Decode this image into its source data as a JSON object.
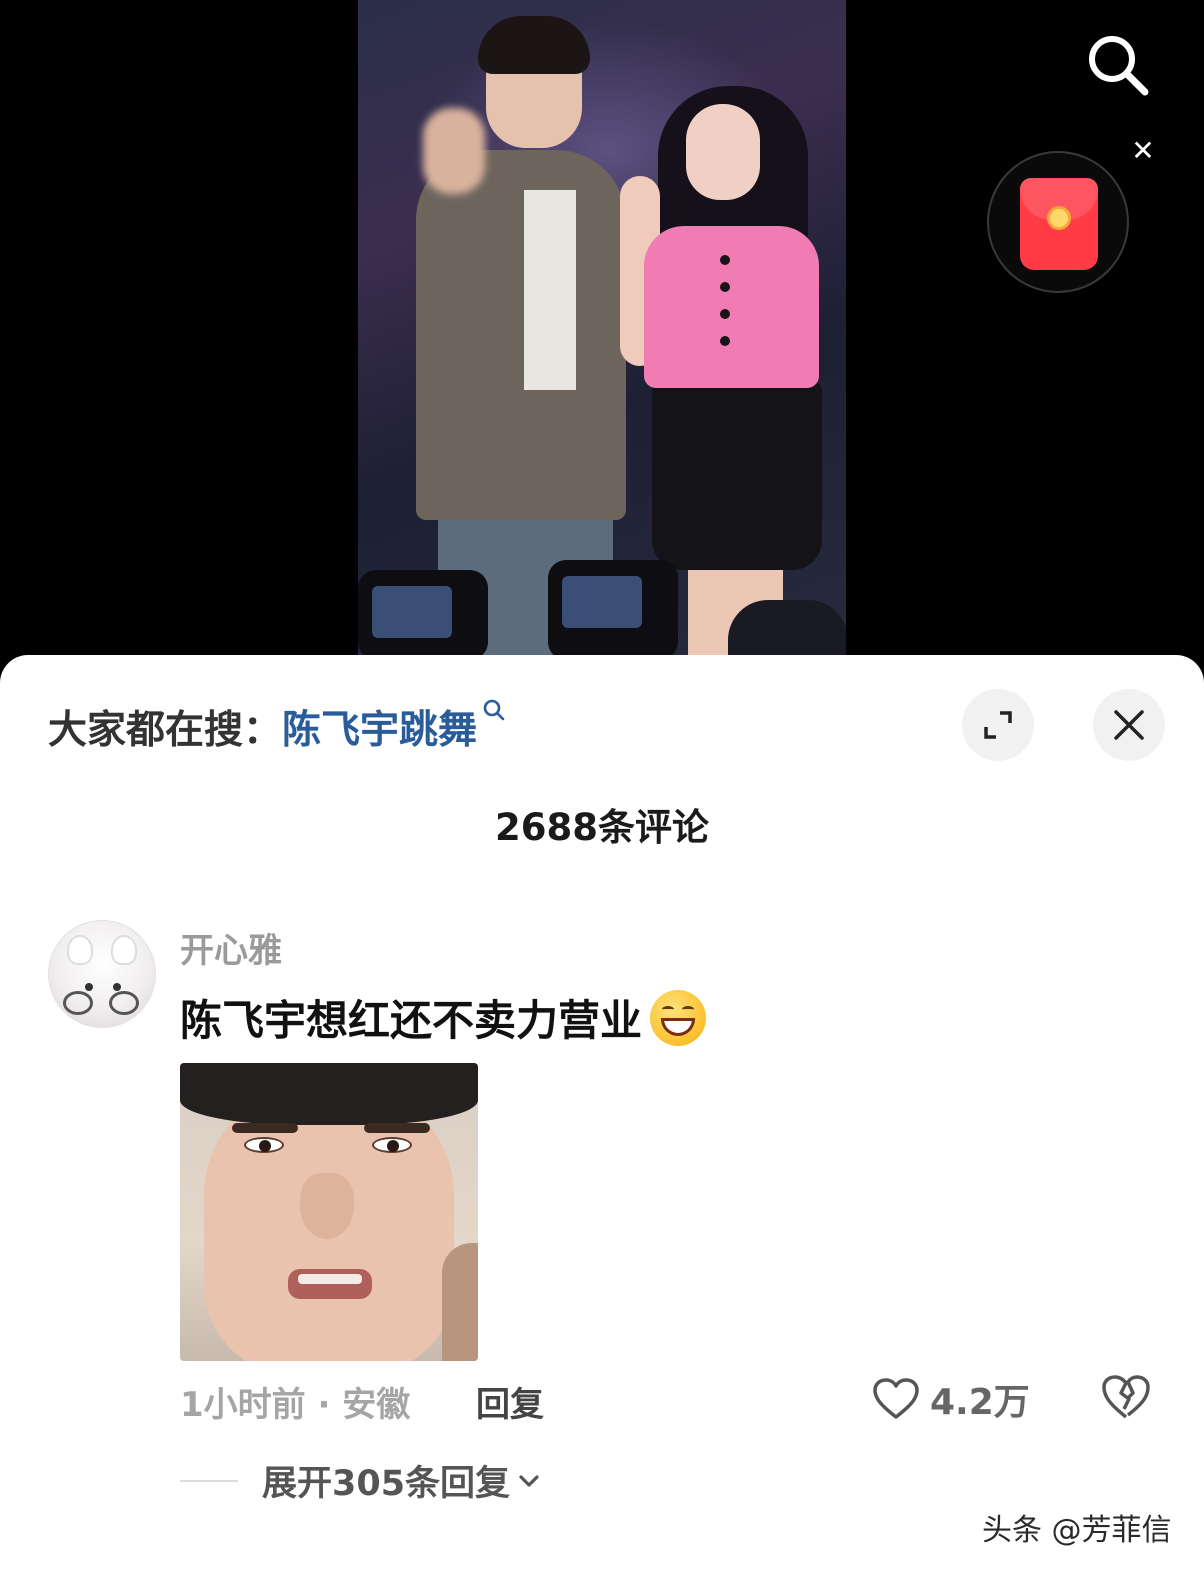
{
  "video": {
    "overlay_icons": [
      "search-icon",
      "close-icon",
      "red-packet-icon"
    ]
  },
  "panel": {
    "hot_search_prefix": "大家都在搜：",
    "hot_search_keyword": "陈飞宇跳舞",
    "expand_icon": "expand-icon",
    "close_icon": "close-icon",
    "comment_count": "2688条评论"
  },
  "comment": {
    "username": "开心雅",
    "text": "陈飞宇想红还不卖力营业",
    "emoji": "grin-emoji",
    "time_location": "1小时前 · 安徽",
    "reply_label": "回复",
    "like_count": "4.2万",
    "expand_replies": "展开305条回复"
  },
  "watermark": "头条 @芳菲信",
  "colors": {
    "keyword": "#2a5c9a",
    "red_packet": "#ff3b46",
    "panel_bg": "#ffffff"
  }
}
